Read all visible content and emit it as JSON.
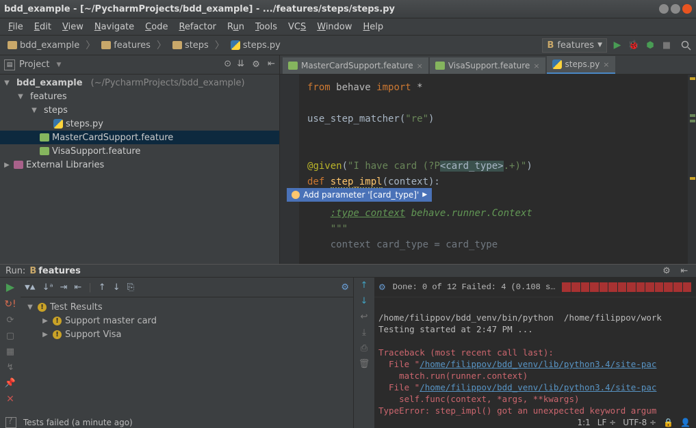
{
  "title": "bdd_example - [~/PycharmProjects/bdd_example] - .../features/steps/steps.py",
  "menu": [
    "File",
    "Edit",
    "View",
    "Navigate",
    "Code",
    "Refactor",
    "Run",
    "Tools",
    "VCS",
    "Window",
    "Help"
  ],
  "breadcrumb": [
    {
      "icon": "folder",
      "label": "bdd_example"
    },
    {
      "icon": "folder",
      "label": "features"
    },
    {
      "icon": "folder",
      "label": "steps"
    },
    {
      "icon": "py",
      "label": "steps.py"
    }
  ],
  "run_config": {
    "prefix": "B",
    "name": "features"
  },
  "project_panel": {
    "title": "Project"
  },
  "tree": {
    "root": {
      "name": "bdd_example",
      "path": "(~/PycharmProjects/bdd_example)"
    },
    "features": "features",
    "steps": "steps",
    "steps_py": "steps.py",
    "mc": "MasterCardSupport.feature",
    "visa": "VisaSupport.feature",
    "ext": "External Libraries"
  },
  "tabs": [
    {
      "icon": "feat",
      "label": "MasterCardSupport.feature",
      "active": false
    },
    {
      "icon": "feat",
      "label": "VisaSupport.feature",
      "active": false
    },
    {
      "icon": "py",
      "label": "steps.py",
      "active": true
    }
  ],
  "code": {
    "l1_from": "from",
    "l1_behave": " behave ",
    "l1_import": "import",
    "l1_star": " *",
    "l3_call": "use_step_matcher(",
    "l3_arg": "\"re\"",
    "l3_end": ")",
    "l6_at": "@",
    "l6_given": "given",
    "l6_open": "(",
    "l6_s1": "\"I have card (?P",
    "l6_cap": "<card_type>",
    "l6_s2": ".+)\"",
    "l6_close": ")",
    "l7_def": "def ",
    "l7_name": "step_impl",
    "l7_par": "(context):",
    "intent": "Add parameter '[card_type]'",
    "l9_doc": ":type",
    "l9_doc2": " context",
    "l9_doc3": " behave.runner.Context",
    "l10": "\"\"\"",
    "l11": "context card_type = card_type"
  },
  "run": {
    "label": "Run:",
    "name": "features",
    "done": "Done: 0 of 12  Failed: 4  (0.108 s…",
    "tests": {
      "root": "Test Results",
      "t1": "Support master card",
      "t2": "Support Visa"
    }
  },
  "console": {
    "l1": "/home/filippov/bdd_venv/bin/python  /home/filippov/work",
    "l2": "Testing started at 2:47 PM ...",
    "l4": "Traceback (most recent call last):",
    "l5a": "  File \"",
    "l5b": "/home/filippov/bdd_venv/lib/python3.4/site-pac",
    "l6": "    match.run(runner.context)",
    "l7a": "  File \"",
    "l7b": "/home/filippov/bdd_venv/lib/python3.4/site-pac",
    "l8": "    self.func(context, *args, **kwargs)",
    "l9": "TypeError: step_impl() got an unexpected keyword argum"
  },
  "status": {
    "msg": "Tests failed (a minute ago)",
    "pos": "1:1",
    "lf": "LF",
    "enc": "UTF-8"
  }
}
